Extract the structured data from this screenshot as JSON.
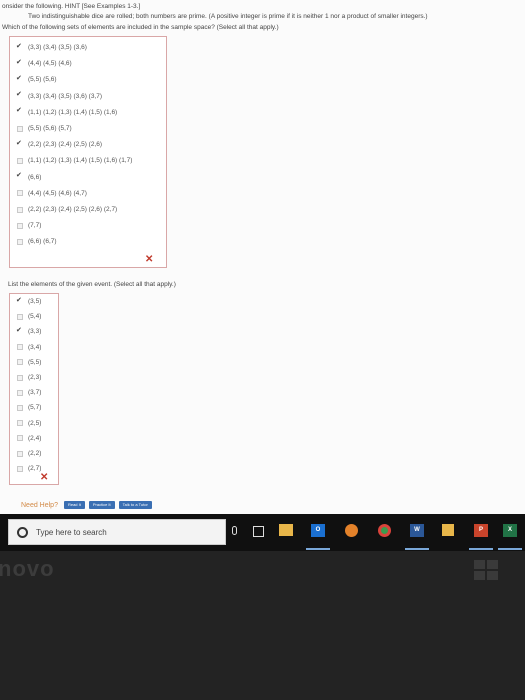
{
  "intro": "onsider the following. HINT [See Examples 1-3.]",
  "subtitle": "Two indistinguishable dice are rolled; both numbers are prime. (A positive integer is prime if it is neither 1 nor a product of smaller integers.)",
  "question": "Which of the following sets of elements are included in the sample space? (Select all that apply.)",
  "options": [
    {
      "label": "(3,3) (3,4) (3,5) (3,6)",
      "checked": true
    },
    {
      "label": "(4,4) (4,5) (4,6)",
      "checked": true
    },
    {
      "label": "(5,5) (5,6)",
      "checked": true
    },
    {
      "label": "(3,3) (3,4) (3,5) (3,6) (3,7)",
      "checked": true
    },
    {
      "label": "(1,1) (1,2) (1,3) (1,4) (1,5) (1,6)",
      "checked": true
    },
    {
      "label": "(5,5) (5,6) (5,7)",
      "checked": false
    },
    {
      "label": "(2,2) (2,3) (2,4) (2,5) (2,6)",
      "checked": true
    },
    {
      "label": "(1,1) (1,2) (1,3) (1,4) (1,5) (1,6) (1,7)",
      "checked": false
    },
    {
      "label": "(6,6)",
      "checked": true
    },
    {
      "label": "(4,4) (4,5) (4,6) (4,7)",
      "checked": false
    },
    {
      "label": "(2,2) (2,3) (2,4) (2,5) (2,6) (2,7)",
      "checked": false
    },
    {
      "label": "(7,7)",
      "checked": false
    },
    {
      "label": "(6,6) (6,7)",
      "checked": false
    }
  ],
  "question2": "List the elements of the given event. (Select all that apply.)",
  "options2": [
    {
      "label": "(3,5)",
      "checked": true
    },
    {
      "label": "(5,4)",
      "checked": false
    },
    {
      "label": "(3,3)",
      "checked": true
    },
    {
      "label": "(3,4)",
      "checked": false
    },
    {
      "label": "(5,5)",
      "checked": false
    },
    {
      "label": "(2,3)",
      "checked": false
    },
    {
      "label": "(3,7)",
      "checked": false
    },
    {
      "label": "(5,7)",
      "checked": false
    },
    {
      "label": "(2,5)",
      "checked": false
    },
    {
      "label": "(2,4)",
      "checked": false
    },
    {
      "label": "(2,2)",
      "checked": false
    },
    {
      "label": "(2,7)",
      "checked": false
    }
  ],
  "wrong_mark": "✕",
  "help": {
    "label": "Need Help?",
    "read": "Read It",
    "practice": "Practice It",
    "tutor": "Talk to a Tutor"
  },
  "taskbar": {
    "search_placeholder": "Type here to search",
    "outlook": "O",
    "word": "W",
    "powerpoint": "P",
    "excel": "X"
  },
  "bezel_logo": "novo"
}
